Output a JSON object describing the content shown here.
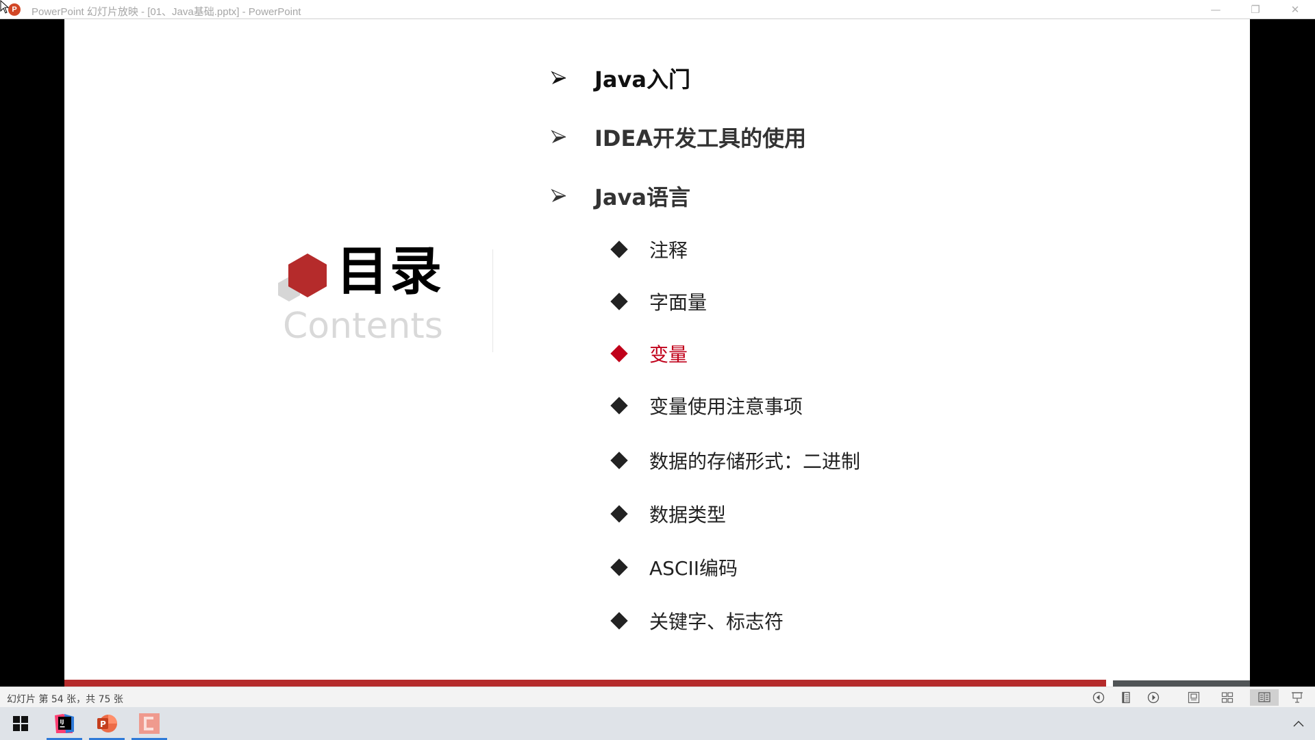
{
  "window": {
    "title": "PowerPoint 幻灯片放映 - [01、Java基础.pptx] - PowerPoint",
    "app_icon_letter": "P",
    "controls": {
      "minimize": "—",
      "restore": "❐",
      "close": "✕"
    }
  },
  "slide": {
    "title": "目录",
    "subtitle": "Contents",
    "main_items": [
      {
        "label": "Java入门"
      },
      {
        "label": "IDEA开发工具的使用"
      },
      {
        "label": "Java语言"
      }
    ],
    "sub_items": [
      {
        "label": "注释",
        "active": false
      },
      {
        "label": "字面量",
        "active": false
      },
      {
        "label": "变量",
        "active": true
      },
      {
        "label": "变量使用注意事项",
        "active": false
      },
      {
        "label": "数据的存储形式：二进制",
        "active": false
      },
      {
        "label": "数据类型",
        "active": false
      },
      {
        "label": "ASCII编码",
        "active": false
      },
      {
        "label": "关键字、标志符",
        "active": false
      }
    ],
    "colors": {
      "accent": "#b52b2b",
      "active_item": "#c0001a",
      "logo_gray": "#d6d6d6"
    }
  },
  "progress": {
    "current": 54,
    "total": 75
  },
  "statusbar": {
    "slide_count": "幻灯片 第 54 张，共 75 张",
    "buttons": [
      {
        "name": "previous-slide",
        "icon": "previous-icon",
        "active": false
      },
      {
        "name": "slide-menu",
        "icon": "menu-icon",
        "active": false
      },
      {
        "name": "next-slide",
        "icon": "next-icon",
        "active": false
      },
      {
        "name": "normal-view",
        "icon": "normal-view-icon",
        "active": false
      },
      {
        "name": "slide-sorter",
        "icon": "slide-sorter-icon",
        "active": false
      },
      {
        "name": "reading-view",
        "icon": "reading-view-icon",
        "active": true
      },
      {
        "name": "slide-show",
        "icon": "slide-show-icon",
        "active": false
      }
    ]
  },
  "taskbar": {
    "items": [
      {
        "name": "start",
        "icon": "windows-icon"
      },
      {
        "name": "intellij-idea",
        "icon": "intellij-icon",
        "label": "IJ",
        "running": true
      },
      {
        "name": "powerpoint",
        "icon": "powerpoint-icon",
        "label": "P",
        "running": true
      },
      {
        "name": "app-c",
        "icon": "c-app-icon",
        "label": "C",
        "running": true
      }
    ],
    "tray_chevron": "^"
  }
}
